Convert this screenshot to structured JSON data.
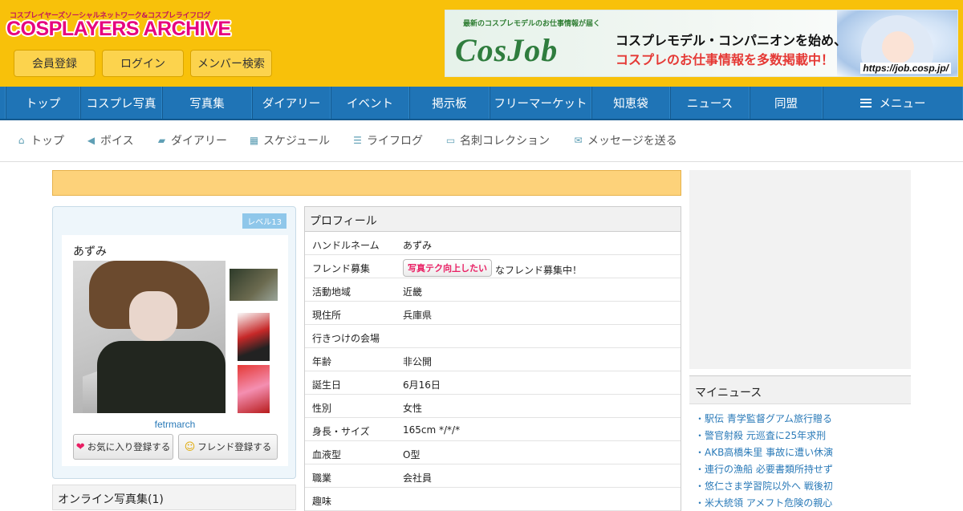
{
  "header": {
    "logo_tagline": "コスプレイヤーズソーシャルネットワーク&コスプレライフログ",
    "logo_title": "COSPLAYERS ARCHIVE",
    "buttons": [
      "会員登録",
      "ログイン",
      "メンバー検索"
    ],
    "banner": {
      "tagline": "最新のコスプレモデルのお仕事情報が届く",
      "logo": "CosJob",
      "line1": "コスプレモデル・コンパニオンを始め、",
      "line2": "コスプレのお仕事情報を多数掲載中！",
      "url": "https://job.cosp.jp/"
    }
  },
  "nav": {
    "items": [
      "トップ",
      "コスプレ写真",
      "写真集",
      "ダイアリー",
      "イベント",
      "掲示板",
      "フリーマーケット",
      "知恵袋",
      "ニュース",
      "同盟"
    ],
    "menu_label": "メニュー"
  },
  "subnav": {
    "items": [
      {
        "icon": "home-icon",
        "label": "トップ"
      },
      {
        "icon": "megaphone-icon",
        "label": "ボイス"
      },
      {
        "icon": "book-icon",
        "label": "ダイアリー"
      },
      {
        "icon": "calendar-icon",
        "label": "スケジュール"
      },
      {
        "icon": "list-icon",
        "label": "ライフログ"
      },
      {
        "icon": "card-icon",
        "label": "名刺コレクション"
      },
      {
        "icon": "envelope-icon",
        "label": "メッセージを送る"
      }
    ]
  },
  "user": {
    "level": "レベル13",
    "name": "あずみ",
    "id": "fetrmarch",
    "favorite_button": "お気に入り登録する",
    "friend_button": "フレンド登録する"
  },
  "album": {
    "title": "オンライン写真集(1)"
  },
  "profile": {
    "title": "プロフィール",
    "rows": [
      {
        "label": "ハンドルネーム",
        "value": "あずみ"
      },
      {
        "label": "フレンド募集",
        "tag": "写真テク向上したい",
        "value": "なフレンド募集中！"
      },
      {
        "label": "活動地域",
        "value": "近畿"
      },
      {
        "label": "現住所",
        "value": "兵庫県"
      },
      {
        "label": "行きつけの会場",
        "value": ""
      },
      {
        "label": "年齢",
        "value": "非公開"
      },
      {
        "label": "誕生日",
        "value": "6月16日"
      },
      {
        "label": "性別",
        "value": "女性"
      },
      {
        "label": "身長・サイズ",
        "value": "165cm */*/*"
      },
      {
        "label": "血液型",
        "value": "O型"
      },
      {
        "label": "職業",
        "value": "会社員"
      },
      {
        "label": "趣味",
        "value": ""
      }
    ]
  },
  "my_news": {
    "title": "マイニュース",
    "items": [
      "・駅伝 青学監督グアム旅行贈る",
      "・警官射殺 元巡査に25年求刑",
      "・AKB高橋朱里 事故に遭い休演",
      "・連行の漁船 必要書類所持せず",
      "・悠仁さま学習院以外へ 戦後初",
      "・米大統領 アメフト危険の親心"
    ]
  },
  "colors": {
    "header_bg": "#f8c10a",
    "nav_bg": "#1f74b6",
    "logo": "#e6007e",
    "link": "#2a7ab8"
  }
}
